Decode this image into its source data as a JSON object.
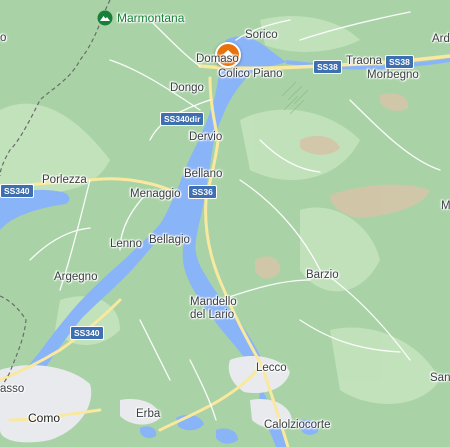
{
  "map": {
    "colors": {
      "land": "#a9d3a6",
      "land_light": "#c3e3bd",
      "water": "#8ab4f8",
      "water_dark": "#7aa6f0",
      "urban": "#e8eaed",
      "road_major": "#f9e89e",
      "road_minor": "#ffffff",
      "border": "#6b6b6b",
      "pin": "#e8710a",
      "shield": "#3e6fb0",
      "terrain_brown": "#d7c3a8"
    },
    "places": {
      "marmontana": "Marmontana",
      "sorico": "Sorico",
      "domaso": "Domaso",
      "colico_piano": "Colico Piano",
      "traona": "Traona",
      "morbegno": "Morbegno",
      "dongo": "Dongo",
      "dervio": "Dervio",
      "bellano": "Bellano",
      "menaggio": "Menaggio",
      "porlezza": "Porlezza",
      "lenno": "Lenno",
      "bellagio": "Bellagio",
      "argegno": "Argegno",
      "barzio": "Barzio",
      "mandello_line1": "Mandello",
      "mandello_line2": "del Lario",
      "lecco": "Lecco",
      "erba": "Erba",
      "como": "Como",
      "calolziocorte": "Calolziocorte",
      "edge_left_top": "o",
      "edge_right_top": "Ard",
      "edge_right_mid": "M",
      "edge_right_low": "San",
      "edge_left_low": "asso"
    },
    "shields": {
      "ss38_a": "SS38",
      "ss38_b": "SS38",
      "ss340dir": "SS340dir",
      "ss36": "SS36",
      "ss340_west": "SS340",
      "ss340_south": "SS340"
    },
    "icons": {
      "poi": "mountain-pin-icon",
      "home": "home-pin-icon"
    }
  }
}
